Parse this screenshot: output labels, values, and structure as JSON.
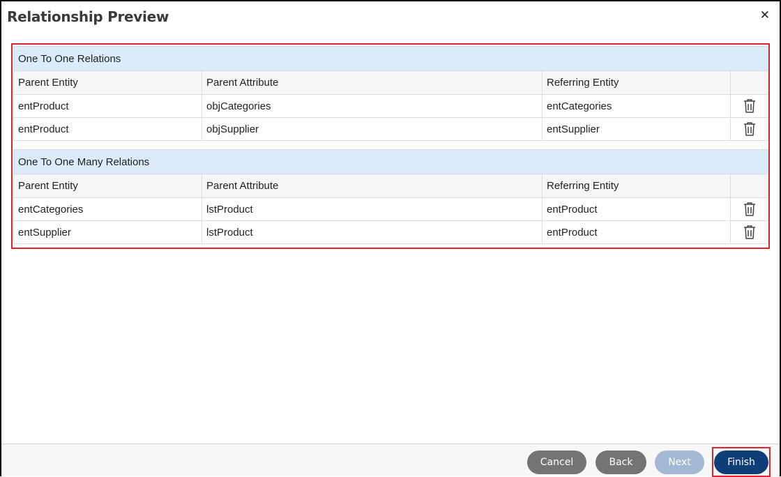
{
  "dialog": {
    "title": "Relationship Preview",
    "close_glyph": "✕"
  },
  "sections": [
    {
      "title": "One To One Relations",
      "headers": [
        "Parent Entity",
        "Parent Attribute",
        "Referring Entity"
      ],
      "rows": [
        [
          "entProduct",
          "objCategories",
          "entCategories"
        ],
        [
          "entProduct",
          "objSupplier",
          "entSupplier"
        ]
      ]
    },
    {
      "title": "One To One Many Relations",
      "headers": [
        "Parent Entity",
        "Parent Attribute",
        "Referring Entity"
      ],
      "rows": [
        [
          "entCategories",
          "lstProduct",
          "entProduct"
        ],
        [
          "entSupplier",
          "lstProduct",
          "entProduct"
        ]
      ]
    }
  ],
  "footer": {
    "cancel": "Cancel",
    "back": "Back",
    "next": "Next",
    "finish": "Finish"
  },
  "icons": {
    "close": "close-icon",
    "delete": "trash-icon"
  },
  "colors": {
    "section_bg": "#dcebfa",
    "finish": "#0f3f77",
    "next_disabled": "#a2b9d1",
    "highlight": "#d9252e"
  }
}
